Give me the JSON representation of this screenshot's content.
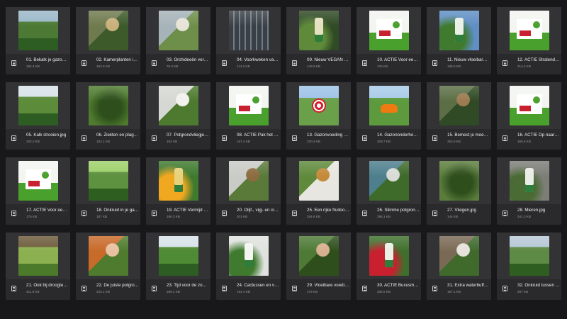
{
  "files": [
    {
      "name": "01. Bekalk je gazon in ...",
      "size": "184.4 KB",
      "thumb": {
        "bg": "#4c7a35",
        "fg": "#2e5d23",
        "accent": "#9ab8c9",
        "kind": "field"
      }
    },
    {
      "name": "02. Kamerplanten in ...",
      "size": "163.3 KB",
      "thumb": {
        "bg": "#6f7a4e",
        "fg": "#3d5a2b",
        "accent": "#c8b07a",
        "kind": "plants"
      }
    },
    {
      "name": "03. Orchideeën verzor...",
      "size": "76.3 KB",
      "thumb": {
        "bg": "#a6b3b8",
        "fg": "#6e8f4a",
        "accent": "#e7e3d8",
        "kind": "plants"
      }
    },
    {
      "name": "04. Voorkweken van z...",
      "size": "114.2 KB",
      "thumb": {
        "bg": "#3b3f45",
        "fg": "#6d7d86",
        "accent": "#b8c3c7",
        "kind": "tray"
      }
    },
    {
      "name": "09. Nieuw VEGAN tui...",
      "size": "149.9 KB",
      "thumb": {
        "bg": "#2f4a24",
        "fg": "#5f8a3a",
        "accent": "#e6e0c2",
        "kind": "bottle"
      }
    },
    {
      "name": "10. ACTIE Voor een di...",
      "size": "176 KB",
      "thumb": {
        "bg": "#f3f5f1",
        "fg": "#4aa02c",
        "accent": "#c8202f",
        "kind": "badge"
      }
    },
    {
      "name": "11. Nieuw vloeibare vo...",
      "size": "136.5 KB",
      "thumb": {
        "bg": "#5f8fc4",
        "fg": "#3f7a2e",
        "accent": "#e9f0e6",
        "kind": "bottle"
      }
    },
    {
      "name": "12. ACTIE Stralende b...",
      "size": "214.2 KB",
      "thumb": {
        "bg": "#f3f5f1",
        "fg": "#4aa02c",
        "accent": "#c8202f",
        "kind": "badge"
      }
    },
    {
      "name": "05. Kalk strooien.jpg",
      "size": "232.2 KB",
      "thumb": {
        "bg": "#5c8b3a",
        "fg": "#2e5d23",
        "accent": "#d7e2e8",
        "kind": "field"
      }
    },
    {
      "name": "06. Ziekten en plagen...",
      "size": "134.1 KB",
      "thumb": {
        "bg": "#4f7b2e",
        "fg": "#2e4f1c",
        "accent": "#8c6b3f",
        "kind": "leaf"
      }
    },
    {
      "name": "07. Potgrondvliegjes.j...",
      "size": "192 KB",
      "thumb": {
        "bg": "#d6d8d3",
        "fg": "#4d7a2f",
        "accent": "#f1f1ee",
        "kind": "plants"
      }
    },
    {
      "name": "08. ACTIE Pak het mo...",
      "size": "167.4 KB",
      "thumb": {
        "bg": "#f3f5f1",
        "fg": "#4aa02c",
        "accent": "#c8202f",
        "kind": "badge"
      }
    },
    {
      "name": "13. Gazonvoeding die ...",
      "size": "230.4 KB",
      "thumb": {
        "bg": "#6aa04a",
        "fg": "#3b7a2a",
        "accent": "#d2202a",
        "kind": "target"
      }
    },
    {
      "name": "14. Gazononderhoud ...",
      "size": "309.7 KB",
      "thumb": {
        "bg": "#5d9a3e",
        "fg": "#2f6d22",
        "accent": "#f07a12",
        "kind": "mower"
      }
    },
    {
      "name": "15. Bemest je moestui...",
      "size": "252.5 KB",
      "thumb": {
        "bg": "#5b6e45",
        "fg": "#2f4a24",
        "accent": "#9c7b52",
        "kind": "plants"
      }
    },
    {
      "name": "16. ACTIE Op naar de ...",
      "size": "165.5 KB",
      "thumb": {
        "bg": "#f3f5f1",
        "fg": "#4aa02c",
        "accent": "#c8202f",
        "kind": "badge"
      }
    },
    {
      "name": "17. ACTIE Voor een di...",
      "size": "176 KB",
      "thumb": {
        "bg": "#f3f5f1",
        "fg": "#4aa02c",
        "accent": "#c8202f",
        "kind": "badge"
      }
    },
    {
      "name": "18. Onkruid in je gazo...",
      "size": "187 KB",
      "thumb": {
        "bg": "#5e9140",
        "fg": "#2f5f20",
        "accent": "#9ed06a",
        "kind": "field"
      }
    },
    {
      "name": "19. ACTIE Vermijd ee...",
      "size": "166.3 KB",
      "thumb": {
        "bg": "#3f7a2e",
        "fg": "#f0a820",
        "accent": "#e6d27a",
        "kind": "bottle"
      }
    },
    {
      "name": "20. Olijf-, vijg- en citr...",
      "size": "203 KB",
      "thumb": {
        "bg": "#c9cbc6",
        "fg": "#5a7a3a",
        "accent": "#8c6b3f",
        "kind": "plants"
      }
    },
    {
      "name": "25. Een rijke fruitoogs...",
      "size": "254.6 KB",
      "thumb": {
        "bg": "#5f8a3c",
        "fg": "#e8e6e0",
        "accent": "#c48a3a",
        "kind": "plants"
      }
    },
    {
      "name": "26. Slimme potgrond ...",
      "size": "296.1 KB",
      "thumb": {
        "bg": "#4d7f8d",
        "fg": "#3e6a2a",
        "accent": "#d9dcd6",
        "kind": "plants"
      }
    },
    {
      "name": "27. Vliegen.jpg",
      "size": "144 KB",
      "thumb": {
        "bg": "#5b7d3c",
        "fg": "#2e4f1c",
        "accent": "#bcd0b0",
        "kind": "leaf"
      }
    },
    {
      "name": "28. Mieren.jpg",
      "size": "341.3 KB",
      "thumb": {
        "bg": "#7d7e78",
        "fg": "#4a6b33",
        "accent": "#e9ebe6",
        "kind": "bottle"
      }
    },
    {
      "name": "21. Ook bij droogte ee...",
      "size": "411.8 KB",
      "thumb": {
        "bg": "#8bb050",
        "fg": "#4a7a2a",
        "accent": "#6d5a3a",
        "kind": "field"
      }
    },
    {
      "name": "22. De juiste potgron...",
      "size": "233.1 KB",
      "thumb": {
        "bg": "#c86a2a",
        "fg": "#4f7b2e",
        "accent": "#e8c1a0",
        "kind": "plants"
      }
    },
    {
      "name": "23. Tijd voor de zome...",
      "size": "269.2 KB",
      "thumb": {
        "bg": "#4f8a34",
        "fg": "#2e5d23",
        "accent": "#d7e2e8",
        "kind": "field"
      }
    },
    {
      "name": "24. Cactussen en vetp...",
      "size": "164.4 KB",
      "thumb": {
        "bg": "#dfe2df",
        "fg": "#3f7a2e",
        "accent": "#f4f4f2",
        "kind": "bottle"
      }
    },
    {
      "name": "29. Vloeibare voeding...",
      "size": "178 KB",
      "thumb": {
        "bg": "#4e7a36",
        "fg": "#2e4f1c",
        "accent": "#d8b090",
        "kind": "plants"
      }
    },
    {
      "name": "30. ACTIE Buxusmot ...",
      "size": "266.5 KB",
      "thumb": {
        "bg": "#3f6f2c",
        "fg": "#c8202f",
        "accent": "#e9f0e6",
        "kind": "bottle"
      }
    },
    {
      "name": "31. Extra waterbuffer i...",
      "size": "197.1 KB",
      "thumb": {
        "bg": "#7a6a55",
        "fg": "#3f6a2c",
        "accent": "#e5e2dc",
        "kind": "plants"
      }
    },
    {
      "name": "32. Onkruid tussen be...",
      "size": "287 KB",
      "thumb": {
        "bg": "#5d8a45",
        "fg": "#2f5f20",
        "accent": "#b7c8d6",
        "kind": "field"
      }
    }
  ]
}
